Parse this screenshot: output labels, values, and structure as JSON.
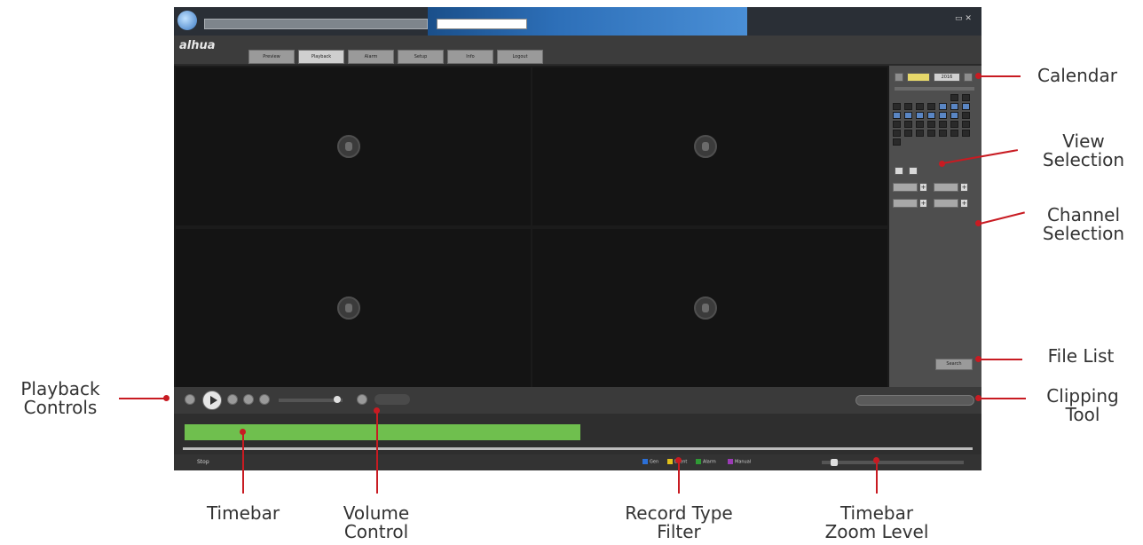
{
  "app": {
    "logo_text": "alhua",
    "nav_tabs": [
      "Preview",
      "Playback",
      "Alarm",
      "Setup",
      "Info",
      "Logout"
    ],
    "active_tab": 1,
    "calendar_year": "2016"
  },
  "status": {
    "left_text": "Stop",
    "record_filters": [
      {
        "label": "Gen",
        "color": "#2b6fd6"
      },
      {
        "label": "Event",
        "color": "#e2c11a"
      },
      {
        "label": "Alarm",
        "color": "#2f9a35"
      },
      {
        "label": "Manual",
        "color": "#9b3bb5"
      }
    ]
  },
  "side": {
    "search_label": "Search"
  },
  "annotations": {
    "calendar": "Calendar",
    "view_selection_1": "View",
    "view_selection_2": "Selection",
    "channel_selection_1": "Channel",
    "channel_selection_2": "Selection",
    "file_list": "File List",
    "clipping_tool_1": "Clipping",
    "clipping_tool_2": "Tool",
    "playback_controls_1": "Playback",
    "playback_controls_2": "Controls",
    "timebar": "Timebar",
    "volume_control_1": "Volume",
    "volume_control_2": "Control",
    "record_type_filter_1": "Record Type",
    "record_type_filter_2": "Filter",
    "timebar_zoom_1": "Timebar",
    "timebar_zoom_2": "Zoom Level"
  },
  "colors": {
    "accent": "#c81b22",
    "timebar_fill": "#6fbf4e",
    "record_day": "#5a86c4"
  }
}
